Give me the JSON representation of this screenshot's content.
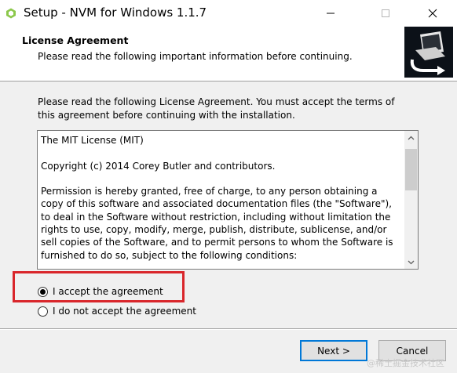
{
  "window": {
    "title": "Setup - NVM for Windows 1.1.7",
    "minimize_icon": "minimize-icon",
    "maximize_icon": "maximize-icon",
    "close_icon": "close-icon"
  },
  "header": {
    "title": "License Agreement",
    "subtitle": "Please read the following important information before continuing."
  },
  "intro_text": "Please read the following License Agreement. You must accept the terms of this agreement before continuing with the installation.",
  "license": {
    "paragraphs": [
      "The MIT License (MIT)",
      "Copyright (c) 2014 Corey Butler and contributors.",
      "Permission is hereby granted, free of charge, to any person obtaining a copy of this software and associated documentation files (the \"Software\"), to deal in the Software without restriction, including without limitation the rights to use, copy, modify, merge, publish, distribute, sublicense, and/or sell copies of the Software, and to permit persons to whom the Software is furnished to do so, subject to the following conditions:"
    ]
  },
  "options": {
    "accept": "I accept the agreement",
    "decline": "I do not accept the agreement",
    "selected": "accept"
  },
  "buttons": {
    "next": "Next >",
    "cancel": "Cancel"
  },
  "watermark": "@稀土掘金技术社区",
  "colors": {
    "highlight": "#d9262b",
    "default_button_border": "#0078d7"
  }
}
